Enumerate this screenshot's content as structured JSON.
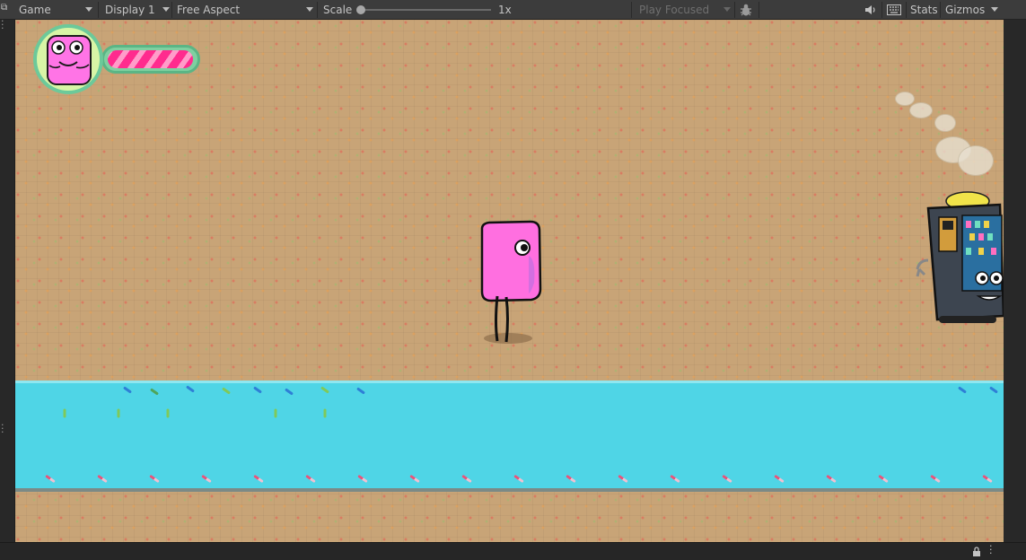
{
  "toolbar": {
    "game_tab": "Game",
    "display": "Display 1",
    "aspect": "Free Aspect",
    "scale_label": "Scale",
    "scale_value": "1x",
    "play_mode": "Play Focused",
    "stats": "Stats",
    "gizmos": "Gizmos"
  },
  "icons": {
    "bug": "bug-icon",
    "audio": "speaker-icon",
    "keyboard": "keyboard-icon",
    "lock": "lock-icon",
    "more": "more-vert-icon"
  },
  "game": {
    "player_health": 0.95,
    "colors": {
      "ground": "#c8a477",
      "river": "#4fd5e6",
      "player": "#ff6fe0",
      "health_bar": "#ff2b8e"
    }
  }
}
